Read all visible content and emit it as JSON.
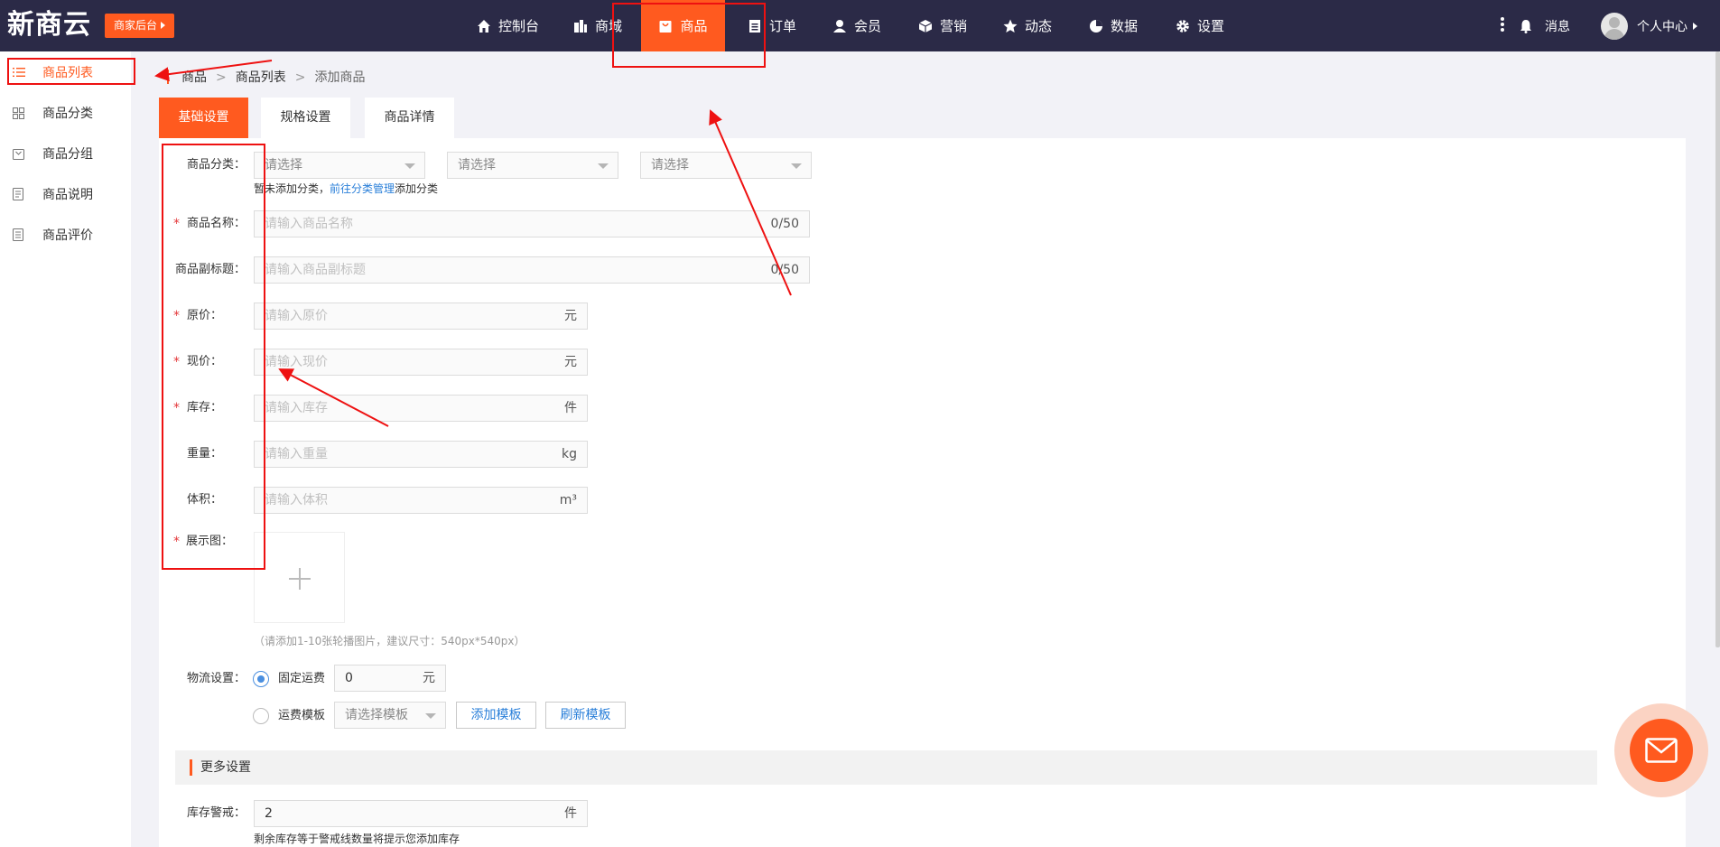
{
  "header": {
    "logo": "新商云",
    "merchant_badge": "商家后台",
    "nav": [
      {
        "label": "控制台",
        "icon": "home-icon"
      },
      {
        "label": "商城",
        "icon": "building-icon"
      },
      {
        "label": "商品",
        "icon": "bag-icon",
        "active": true
      },
      {
        "label": "订单",
        "icon": "clipboard-icon"
      },
      {
        "label": "会员",
        "icon": "user-icon"
      },
      {
        "label": "营销",
        "icon": "box-icon"
      },
      {
        "label": "动态",
        "icon": "star-icon"
      },
      {
        "label": "数据",
        "icon": "pie-chart-icon"
      },
      {
        "label": "设置",
        "icon": "gear-icon"
      }
    ],
    "messages": "消息",
    "user_center": "个人中心"
  },
  "sidebar": {
    "items": [
      {
        "label": "商品列表",
        "icon": "list-icon",
        "active": true
      },
      {
        "label": "商品分类",
        "icon": "grid-icon"
      },
      {
        "label": "商品分组",
        "icon": "folder-icon"
      },
      {
        "label": "商品说明",
        "icon": "note-icon"
      },
      {
        "label": "商品评价",
        "icon": "comment-icon"
      }
    ]
  },
  "breadcrumb": [
    "商品",
    "商品列表",
    "添加商品"
  ],
  "tabs": [
    "基础设置",
    "规格设置",
    "商品详情"
  ],
  "form": {
    "category": {
      "label": "商品分类：",
      "placeholders": [
        "请选择",
        "请选择",
        "请选择"
      ],
      "hint_prefix": "暂未添加分类，",
      "hint_link": "前往分类管理",
      "hint_suffix": "添加分类"
    },
    "name": {
      "label": "商品名称：",
      "placeholder": "请输入商品名称",
      "counter": "0/50"
    },
    "subtitle": {
      "label": "商品副标题：",
      "placeholder": "请输入商品副标题",
      "counter": "0/50"
    },
    "original_price": {
      "label": "原价：",
      "placeholder": "请输入原价",
      "unit": "元"
    },
    "current_price": {
      "label": "现价：",
      "placeholder": "请输入现价",
      "unit": "元"
    },
    "stock": {
      "label": "库存：",
      "placeholder": "请输入库存",
      "unit": "件"
    },
    "weight": {
      "label": "重量：",
      "placeholder": "请输入重量",
      "unit": "kg"
    },
    "volume": {
      "label": "体积：",
      "placeholder": "请输入体积",
      "unit": "m³"
    },
    "gallery": {
      "label": "展示图：",
      "hint": "（请添加1-10张轮播图片，建议尺寸：540px*540px）"
    },
    "shipping": {
      "label": "物流设置：",
      "fixed_label": "固定运费",
      "fixed_value": "0",
      "fixed_unit": "元",
      "template_label": "运费模板",
      "template_placeholder": "请选择模板",
      "add_template": "添加模板",
      "refresh_template": "刷新模板"
    },
    "more_section": "更多设置",
    "stock_warning": {
      "label": "库存警戒：",
      "value": "2",
      "unit": "件",
      "hint": "剩余库存等于警戒线数量将提示您添加库存"
    }
  },
  "colors": {
    "accent": "#ff5a1f",
    "topbar": "#2b2a47",
    "link": "#2a7fd9",
    "annotation": "#e11111"
  }
}
